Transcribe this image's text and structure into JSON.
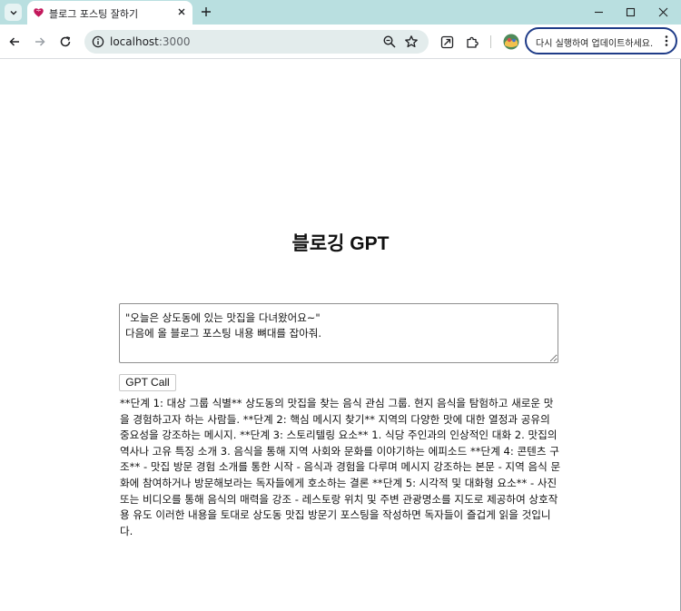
{
  "browser": {
    "tab": {
      "title": "블로그 포스팅 잘하기"
    },
    "address_bar": {
      "host": "localhost",
      "port": ":3000"
    },
    "update_button": {
      "label": "다시 실행하여 업데이트하세요."
    }
  },
  "page": {
    "title": "블로깅 GPT",
    "prompt": {
      "value": "\"오늘은 상도동에 있는 맛집을 다녀왔어요~\"\n다음에 올 블로그 포스팅 내용 뼈대를 잡아줘."
    },
    "submit_label": "GPT Call",
    "result": "**단계 1: 대상 그룹 식별** 상도동의 맛집을 찾는 음식 관심 그룹. 현지 음식을 탐험하고 새로운 맛을 경험하고자 하는 사람들. **단계 2: 핵심 메시지 찾기** 지역의 다양한 맛에 대한 열정과 공유의 중요성을 강조하는 메시지. **단계 3: 스토리텔링 요소** 1. 식당 주인과의 인상적인 대화 2. 맛집의 역사나 고유 특징 소개 3. 음식을 통해 지역 사회와 문화를 이야기하는 에피소드 **단계 4: 콘텐츠 구조** - 맛집 방문 경험 소개를 통한 시작 - 음식과 경험을 다루며 메시지 강조하는 본문 - 지역 음식 문화에 참여하거나 방문해보라는 독자들에게 호소하는 결론 **단계 5: 시각적 및 대화형 요소** - 사진 또는 비디오를 통해 음식의 매력을 강조 - 레스토랑 위치 및 주변 관광명소를 지도로 제공하여 상호작용 유도 이러한 내용을 토대로 상도동 맛집 방문기 포스팅을 작성하면 독자들이 즐겁게 읽을 것입니다."
  },
  "icons": {
    "tab_search": "chevron-down-icon",
    "favicon": "heart-brain-favicon",
    "tab_close": "close-icon",
    "new_tab": "plus-icon",
    "minimize": "minimize-icon",
    "maximize": "maximize-icon",
    "window_close": "close-icon",
    "back": "arrow-left-icon",
    "forward": "arrow-right-icon",
    "reload": "reload-icon",
    "site_info": "info-icon",
    "zoom": "zoom-icon",
    "bookmark": "star-icon",
    "send_tab": "send-icon",
    "extensions": "puzzle-icon",
    "profile": "avatar-icon",
    "menu": "kebab-icon"
  },
  "colors": {
    "tabstrip": "#b9dfe0",
    "omnibox": "#e3ecec",
    "update_border": "#1f3c88",
    "favicon": "#c2185b"
  }
}
